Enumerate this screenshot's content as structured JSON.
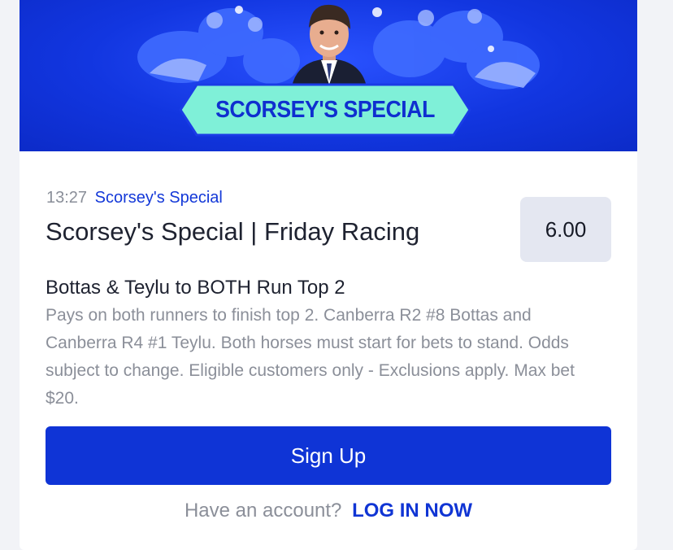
{
  "banner": {
    "heading": "SCORSEY'S SPECIAL"
  },
  "event": {
    "time": "13:27",
    "category_link": "Scorsey's Special",
    "title": "Scorsey's Special | Friday Racing",
    "odds": "6.00"
  },
  "market": {
    "name": "Bottas & Teylu to BOTH Run Top 2",
    "description": "Pays on both runners to finish top 2. Canberra R2 #8 Bottas and Canberra R4 #1 Teylu. Both horses must start for bets to stand. Odds subject to change. Eligible customers only - Exclusions apply. Max bet $20."
  },
  "cta": {
    "signup_label": "Sign Up",
    "account_question": "Have an account?",
    "login_label": "LOG IN NOW"
  },
  "colors": {
    "brand_blue": "#0f34d6",
    "banner_blue": "#1236e0",
    "pill_mint": "#7ff0d8",
    "odds_bg": "#e4e7f1"
  }
}
